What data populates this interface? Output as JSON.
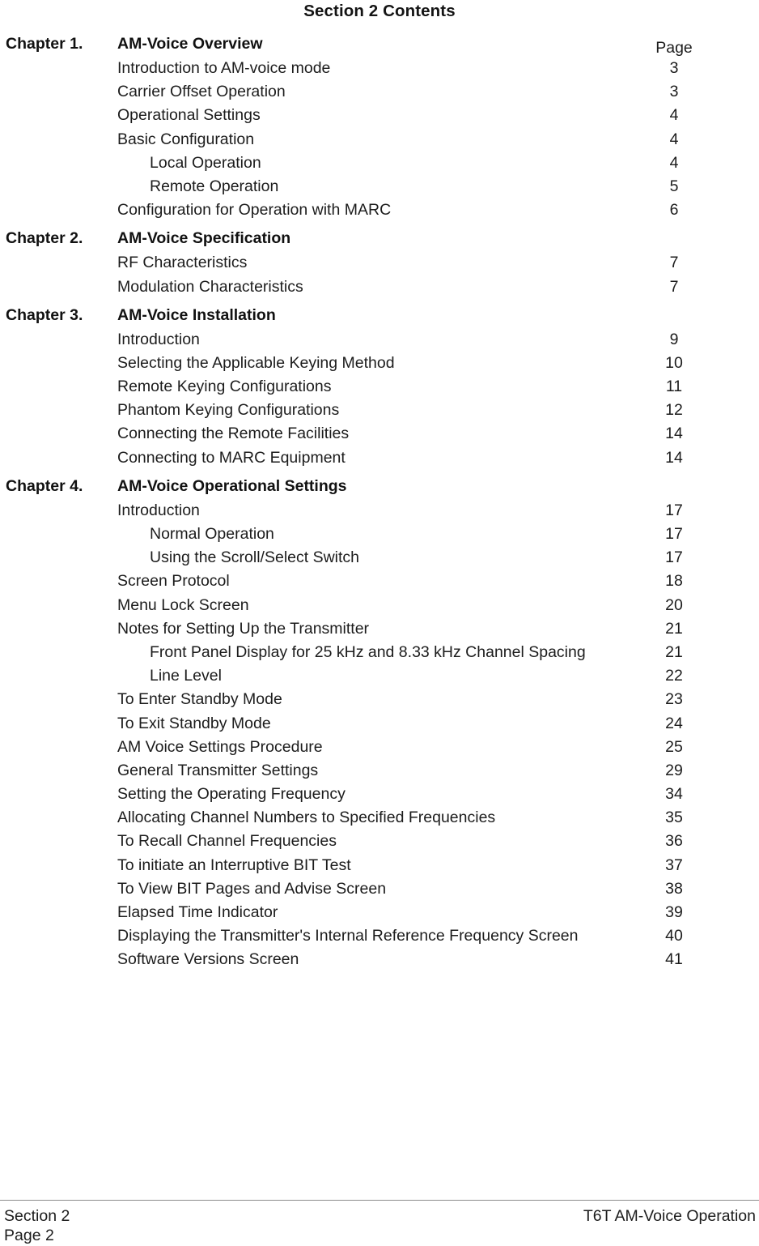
{
  "document": {
    "title": "Section 2 Contents",
    "page_column_header": "Page"
  },
  "chapters": [
    {
      "label": "Chapter 1.",
      "title": "AM-Voice Overview",
      "entries": [
        {
          "text": "Introduction to AM-voice mode",
          "page": "3",
          "indent": false
        },
        {
          "text": "Carrier Offset Operation",
          "page": "3",
          "indent": false
        },
        {
          "text": "Operational Settings",
          "page": "4",
          "indent": false
        },
        {
          "text": "Basic Configuration",
          "page": "4",
          "indent": false
        },
        {
          "text": "Local Operation",
          "page": "4",
          "indent": true
        },
        {
          "text": "Remote Operation",
          "page": "5",
          "indent": true
        },
        {
          "text": "Configuration for Operation with MARC",
          "page": "6",
          "indent": false
        }
      ]
    },
    {
      "label": "Chapter 2.",
      "title": "AM-Voice Specification",
      "entries": [
        {
          "text": "RF Characteristics",
          "page": "7",
          "indent": false
        },
        {
          "text": "Modulation Characteristics",
          "page": "7",
          "indent": false
        }
      ]
    },
    {
      "label": "Chapter 3.",
      "title": "AM-Voice Installation",
      "entries": [
        {
          "text": "Introduction",
          "page": "9",
          "indent": false
        },
        {
          "text": "Selecting the Applicable Keying Method",
          "page": "10",
          "indent": false
        },
        {
          "text": "Remote Keying Configurations",
          "page": "11",
          "indent": false
        },
        {
          "text": "Phantom Keying Configurations",
          "page": "12",
          "indent": false
        },
        {
          "text": "Connecting the Remote Facilities",
          "page": "14",
          "indent": false
        },
        {
          "text": "Connecting to MARC Equipment",
          "page": "14",
          "indent": false
        }
      ]
    },
    {
      "label": "Chapter 4.",
      "title": "AM-Voice Operational Settings",
      "entries": [
        {
          "text": "Introduction",
          "page": "17",
          "indent": false
        },
        {
          "text": "Normal Operation",
          "page": "17",
          "indent": true
        },
        {
          "text": "Using the Scroll/Select Switch",
          "page": "17",
          "indent": true
        },
        {
          "text": "Screen Protocol",
          "page": "18",
          "indent": false
        },
        {
          "text": "Menu Lock Screen",
          "page": "20",
          "indent": false
        },
        {
          "text": "Notes for Setting Up the Transmitter",
          "page": "21",
          "indent": false
        },
        {
          "text": "Front Panel Display for 25 kHz and 8.33 kHz Channel Spacing",
          "page": "21",
          "indent": true
        },
        {
          "text": "Line Level",
          "page": "22",
          "indent": true
        },
        {
          "text": "To Enter Standby Mode",
          "page": "23",
          "indent": false
        },
        {
          "text": "To Exit Standby Mode",
          "page": "24",
          "indent": false
        },
        {
          "text": "AM Voice Settings Procedure",
          "page": "25",
          "indent": false
        },
        {
          "text": "General Transmitter Settings",
          "page": "29",
          "indent": false
        },
        {
          "text": "Setting the Operating Frequency",
          "page": "34",
          "indent": false
        },
        {
          "text": "Allocating Channel Numbers to Specified Frequencies",
          "page": "35",
          "indent": false
        },
        {
          "text": "To Recall Channel Frequencies",
          "page": "36",
          "indent": false
        },
        {
          "text": "To initiate an Interruptive BIT Test",
          "page": "37",
          "indent": false
        },
        {
          "text": "To View BIT Pages and Advise Screen",
          "page": "38",
          "indent": false
        },
        {
          "text": "Elapsed Time Indicator",
          "page": "39",
          "indent": false
        },
        {
          "text": "Displaying the Transmitter's Internal Reference Frequency Screen",
          "page": "40",
          "indent": false
        },
        {
          "text": "Software Versions Screen",
          "page": "41",
          "indent": false
        }
      ]
    }
  ],
  "footer": {
    "left_line1": "Section 2",
    "left_line2": "Page 2",
    "right_line1": "T6T AM-Voice Operation"
  }
}
